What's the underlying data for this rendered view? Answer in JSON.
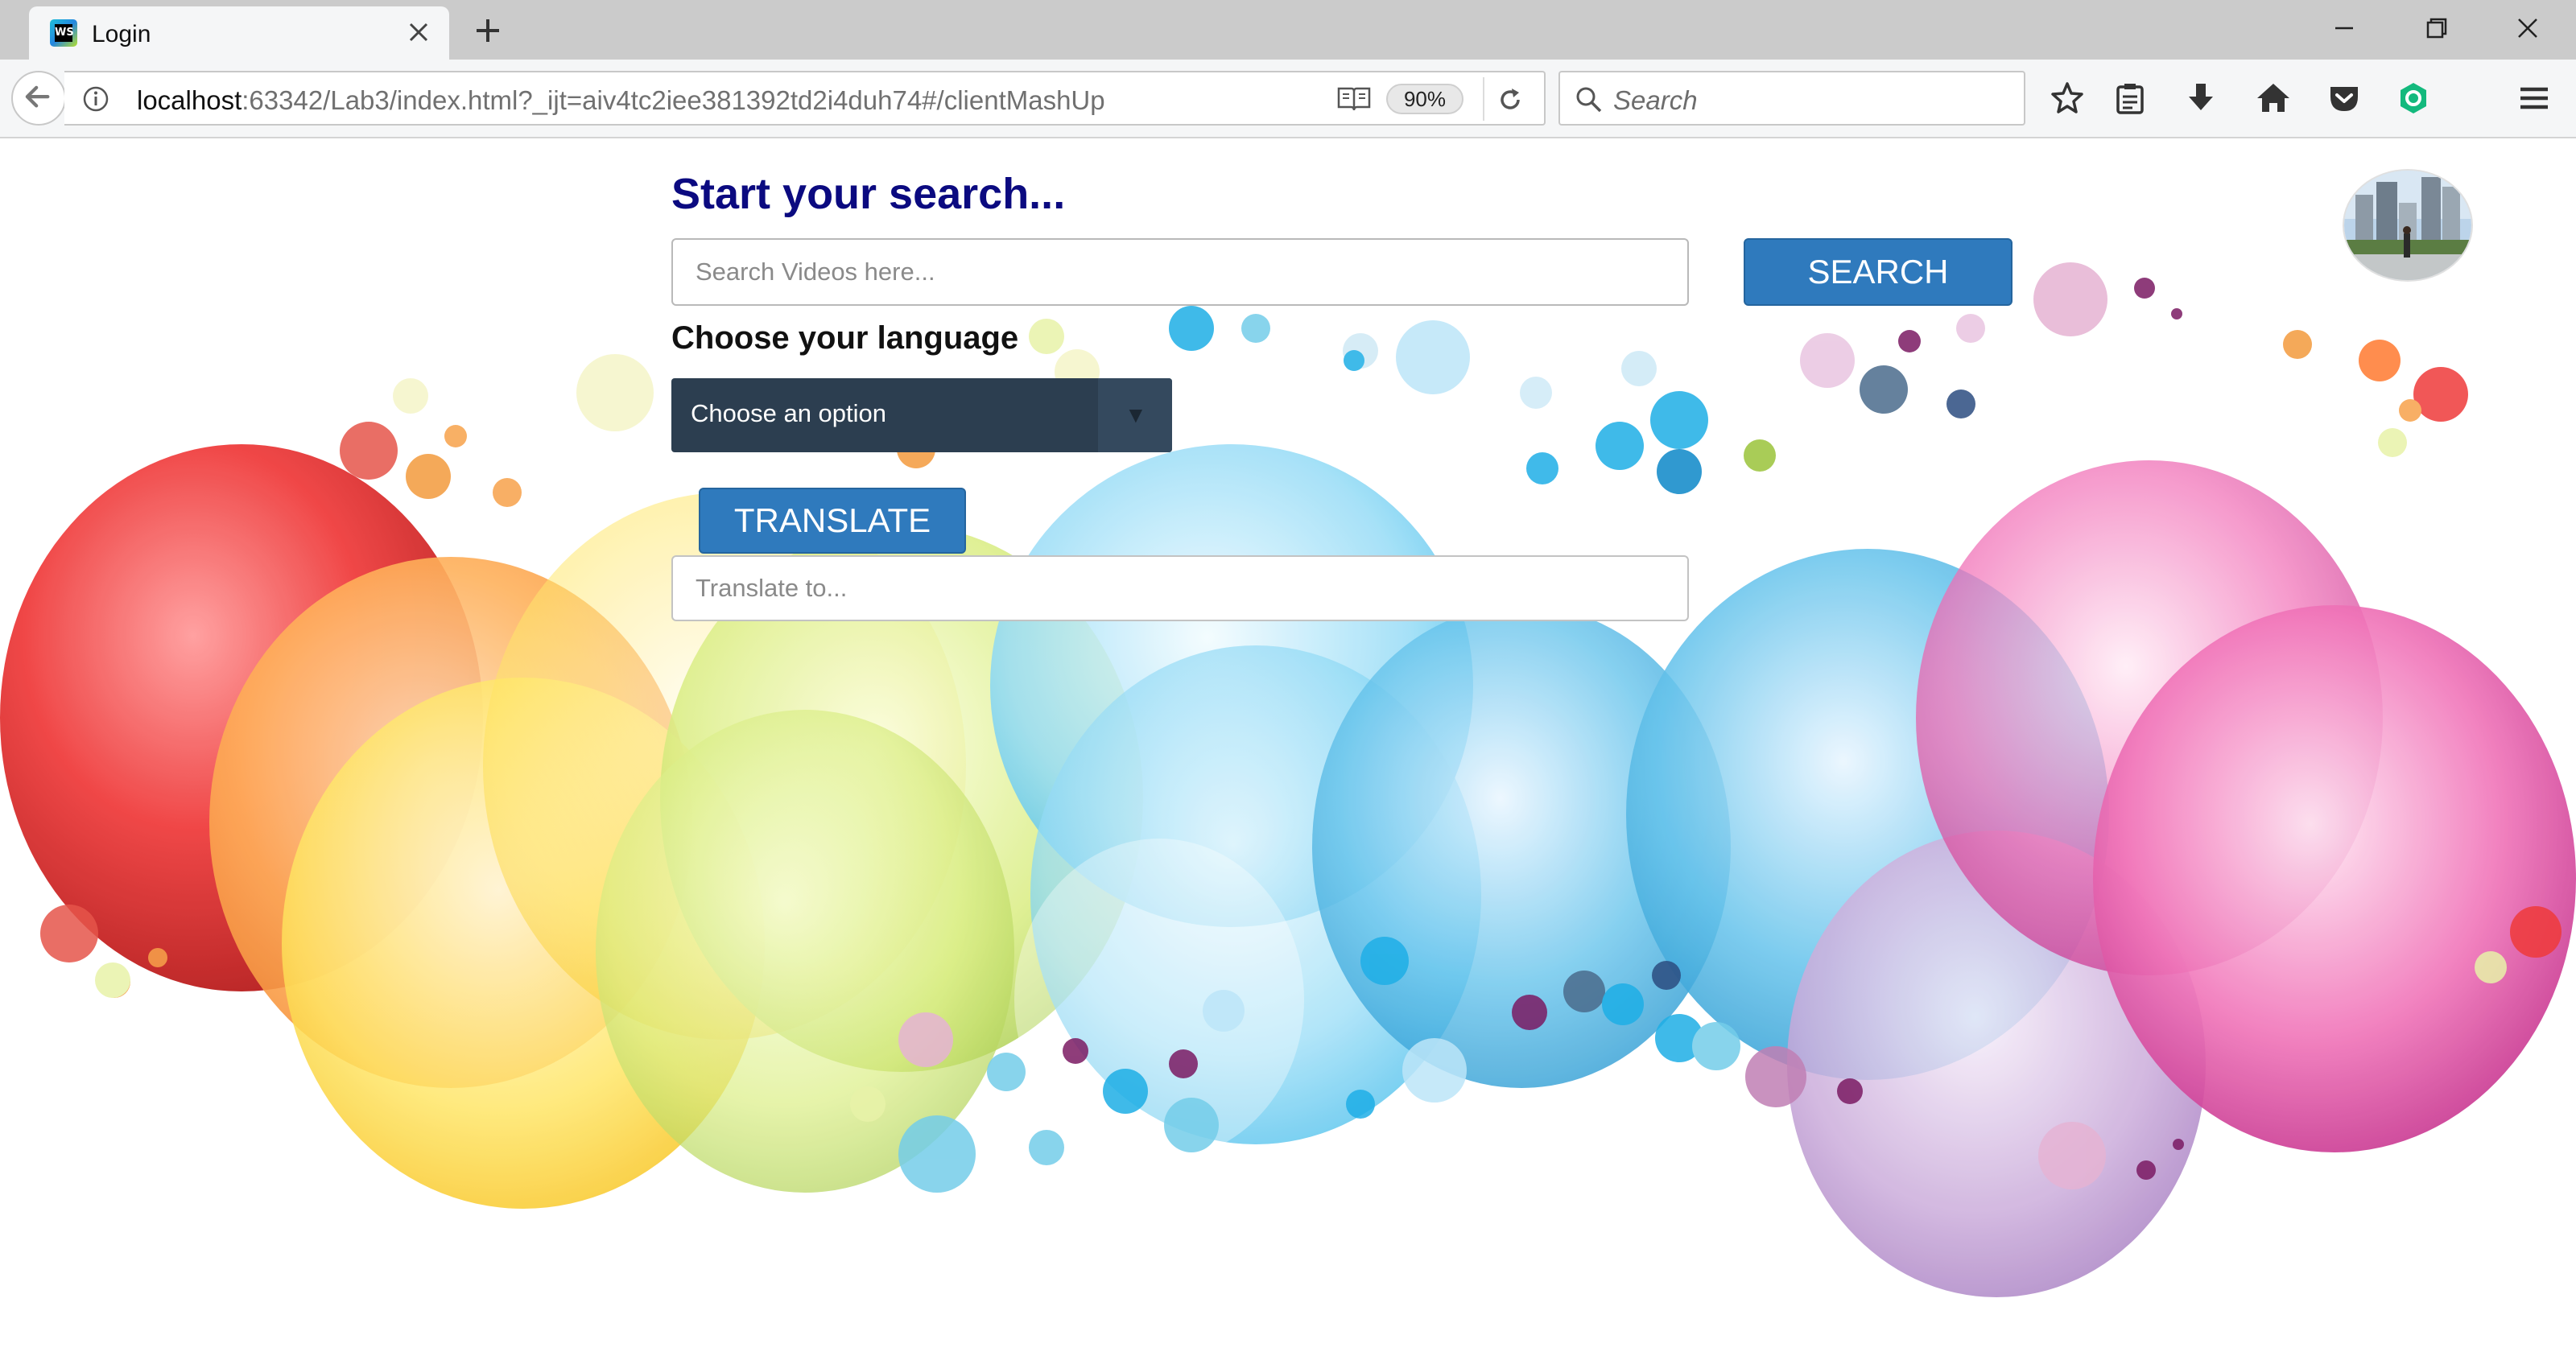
{
  "browser": {
    "tab": {
      "title": "Login",
      "favicon_text": "WS"
    },
    "url": {
      "host": "localhost",
      "rest": ":63342/Lab3/index.html?_ijt=aiv4tc2iee381392td2i4duh74#/clientMashUp"
    },
    "zoom": "90%",
    "search_placeholder": "Search",
    "toolbar_icons": [
      "bookmark-star-icon",
      "reading-list-icon",
      "download-icon",
      "home-icon",
      "pocket-icon",
      "extension-icon",
      "menu-icon"
    ]
  },
  "page": {
    "heading": "Start your search...",
    "search": {
      "placeholder": "Search Videos here...",
      "button": "SEARCH"
    },
    "language": {
      "label": "Choose your language",
      "selected": "Choose an option",
      "arrow": "▼"
    },
    "translate": {
      "button": "TRANSLATE",
      "placeholder": "Translate to..."
    }
  },
  "colors": {
    "heading": "#0b0a80",
    "button": "#2f7abd",
    "select_bg": "#2c3e50"
  }
}
